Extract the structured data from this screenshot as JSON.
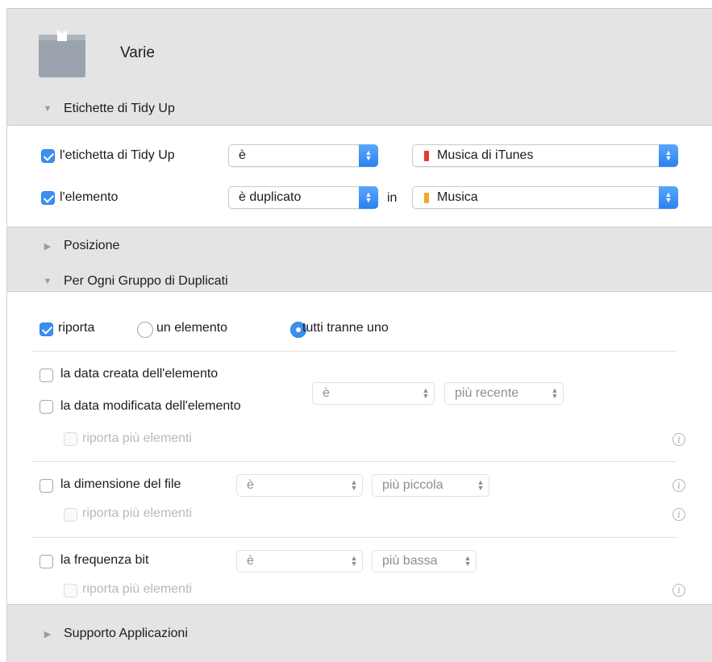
{
  "header": {
    "title": "Varie",
    "icon": "box-icon"
  },
  "sections": {
    "tidy_up_labels": {
      "label": "Etichette di Tidy Up",
      "expanded": true
    },
    "position": {
      "label": "Posizione",
      "expanded": false
    },
    "per_group": {
      "label": "Per Ogni Gruppo di Duplicati",
      "expanded": true
    },
    "app_support": {
      "label": "Supporto Applicazioni",
      "expanded": false
    }
  },
  "tidy_rows": [
    {
      "checked": true,
      "label": "l'etichetta di Tidy Up",
      "operator": "è",
      "connector": "",
      "value": "Musica di iTunes",
      "value_color": "#e8382f"
    },
    {
      "checked": true,
      "label": "l'elemento",
      "operator": "è duplicato",
      "connector": "in",
      "value": "Musica",
      "value_color": "#f5a623"
    }
  ],
  "report": {
    "checked": true,
    "label": "riporta",
    "options": [
      {
        "label": "un elemento",
        "selected": false
      },
      {
        "label": "tutti tranne uno",
        "selected": true
      }
    ]
  },
  "criteria": {
    "dates": {
      "created_label": "la data creata dell'elemento",
      "modified_label": "la data modificata dell'elemento",
      "operator": "è",
      "value": "più recente",
      "multi_label": "riporta più elementi"
    },
    "size": {
      "label": "la dimensione del file",
      "operator": "è",
      "value": "più piccola",
      "multi_label": "riporta più elementi"
    },
    "bitrate": {
      "label": "la frequenza bit",
      "operator": "è",
      "value": "più bassa",
      "multi_label": "riporta più elementi"
    }
  },
  "info_glyph": "i",
  "colors": {
    "accent": "#3b8ff0",
    "itunes_tag": "#e8382f",
    "music_tag": "#f5a623"
  }
}
